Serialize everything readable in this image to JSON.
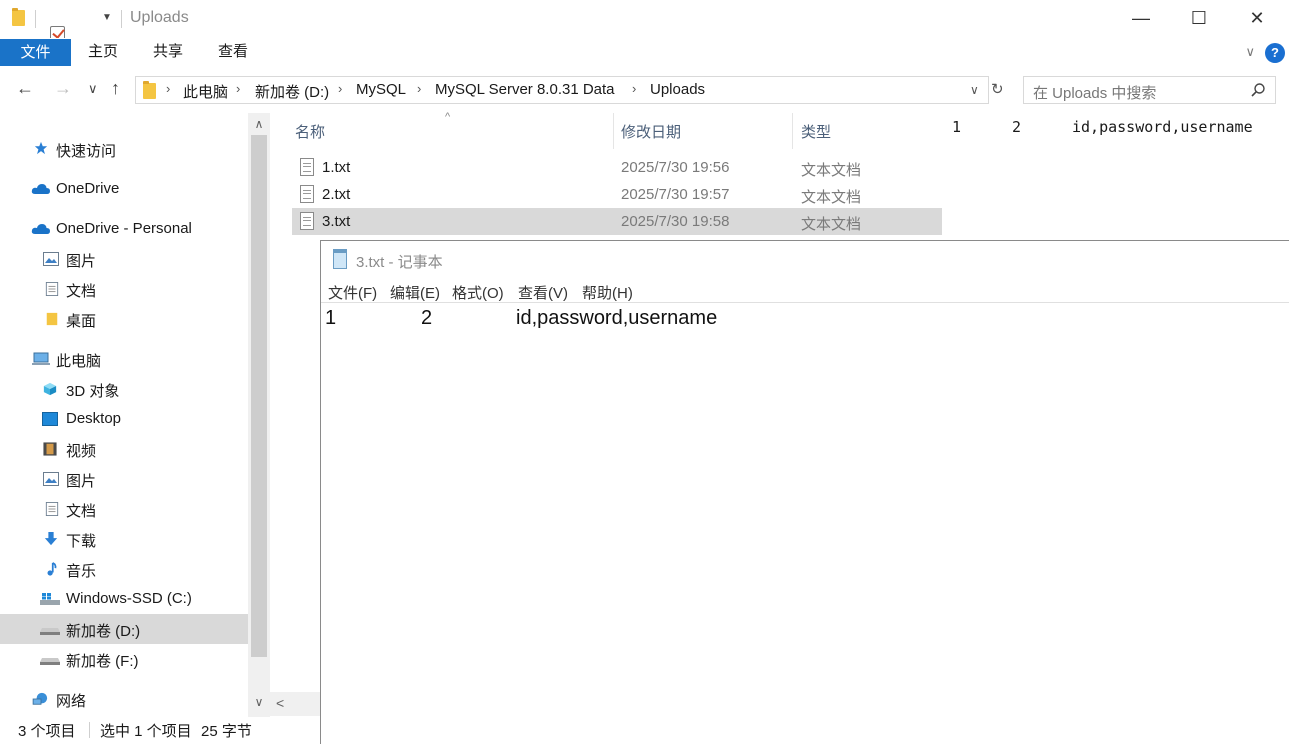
{
  "titlebar": {
    "title": "Uploads",
    "minimize": "—",
    "maximize": "☐",
    "close": "✕"
  },
  "ribbon": {
    "tabs": [
      "文件",
      "主页",
      "共享",
      "查看"
    ],
    "help": "?",
    "expand": "∨"
  },
  "address": {
    "back": "←",
    "forward": "→",
    "recent": "∨",
    "up": "↑",
    "crumbs": [
      "此电脑",
      "新加卷 (D:)",
      "MySQL",
      "MySQL Server 8.0.31 Data",
      "Uploads"
    ],
    "crumb_sep": "›",
    "dropdown": "∨",
    "refresh": "↻",
    "search_placeholder": "在 Uploads 中搜索"
  },
  "nav": {
    "quick_access": "快速访问",
    "onedrive": "OneDrive",
    "onedrive_personal": "OneDrive - Personal",
    "od_pictures": "图片",
    "od_documents": "文档",
    "od_desktop": "桌面",
    "this_pc": "此电脑",
    "objects3d": "3D 对象",
    "desktop": "Desktop",
    "videos": "视频",
    "pictures": "图片",
    "documents": "文档",
    "downloads": "下载",
    "music": "音乐",
    "drive_c": "Windows-SSD (C:)",
    "drive_d": "新加卷 (D:)",
    "drive_f": "新加卷 (F:)",
    "network": "网络"
  },
  "scroll": {
    "up": "∧",
    "down": "∨",
    "left": "<"
  },
  "filelist": {
    "columns": {
      "name": "名称",
      "modified": "修改日期",
      "type": "类型"
    },
    "sort_indicator": "^",
    "files": [
      {
        "name": "1.txt",
        "modified": "2025/7/30 19:56",
        "type": "文本文档"
      },
      {
        "name": "2.txt",
        "modified": "2025/7/30 19:57",
        "type": "文本文档"
      },
      {
        "name": "3.txt",
        "modified": "2025/7/30 19:58",
        "type": "文本文档"
      }
    ]
  },
  "preview": {
    "c1": "1",
    "c2": "2",
    "c3": "id,password,username"
  },
  "status": {
    "count": "3 个项目",
    "selected": "选中 1 个项目",
    "size": "25 字节"
  },
  "notepad": {
    "title": "3.txt - 记事本",
    "menu": [
      "文件(F)",
      "编辑(E)",
      "格式(O)",
      "查看(V)",
      "帮助(H)"
    ],
    "content": {
      "c1": "1",
      "c2": "2",
      "c3": "id,password,username"
    }
  },
  "colors": {
    "accent": "#1a73c8",
    "selection": "#d9d9d9",
    "folder": "#f4c542"
  }
}
